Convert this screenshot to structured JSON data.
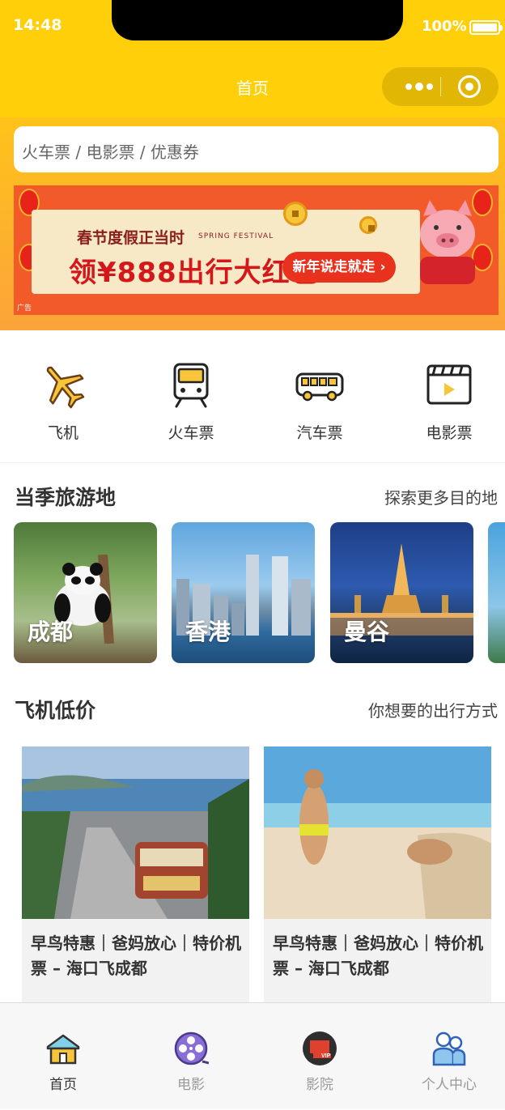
{
  "status": {
    "time": "14:48",
    "battery": "100%"
  },
  "nav": {
    "title": "首页"
  },
  "search": {
    "text": "火车票 / 电影票 / 优惠券"
  },
  "banner": {
    "subtitle": "春节度假正当时",
    "subtitle_en": "SPRING FESTIVAL",
    "headline": "领¥888出行大红包",
    "cta": "新年说走就走",
    "ad_tag": "广告"
  },
  "categories": [
    {
      "label": "飞机",
      "icon": "airplane-icon"
    },
    {
      "label": "火车票",
      "icon": "train-icon"
    },
    {
      "label": "汽车票",
      "icon": "bus-icon"
    },
    {
      "label": "电影票",
      "icon": "movie-icon"
    }
  ],
  "destinations": {
    "title": "当季旅游地",
    "link": "探索更多目的地",
    "items": [
      {
        "name": "成都"
      },
      {
        "name": "香港"
      },
      {
        "name": "曼谷"
      }
    ]
  },
  "deals": {
    "title": "飞机低价",
    "link": "你想要的出行方式",
    "items": [
      {
        "text": "早鸟特惠｜爸妈放心｜特价机票 – 海口飞成都"
      },
      {
        "text": "早鸟特惠｜爸妈放心｜特价机票 – 海口飞成都"
      }
    ]
  },
  "tabs": [
    {
      "label": "首页",
      "icon": "home-icon",
      "active": true
    },
    {
      "label": "电影",
      "icon": "film-reel-icon",
      "active": false
    },
    {
      "label": "影院",
      "icon": "vip-cinema-icon",
      "active": false
    },
    {
      "label": "个人中心",
      "icon": "user-center-icon",
      "active": false
    }
  ],
  "colors": {
    "brand": "#FFCF0A",
    "accent": "#F7A11C"
  }
}
